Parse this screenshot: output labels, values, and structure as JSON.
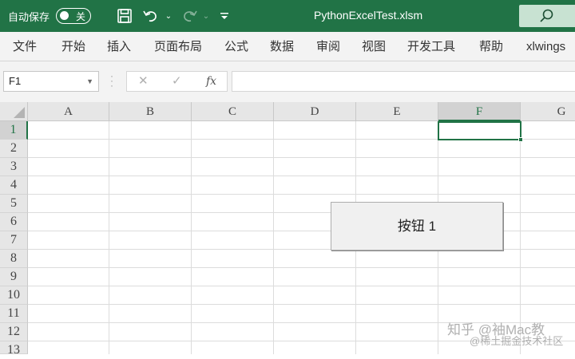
{
  "titlebar": {
    "autosave_label": "自动保存",
    "autosave_state": "关",
    "filename": "PythonExcelTest.xlsm",
    "icons": [
      "save-icon",
      "undo-icon",
      "redo-icon",
      "customize-toolbar-icon",
      "search-icon"
    ],
    "colors": {
      "accent": "#217346",
      "text": "#ffffff"
    }
  },
  "ribbon": {
    "tabs": [
      "文件",
      "开始",
      "插入",
      "页面布局",
      "公式",
      "数据",
      "审阅",
      "视图",
      "开发工具",
      "帮助",
      "xlwings"
    ]
  },
  "formula_bar": {
    "name_box": "F1",
    "cancel": "✕",
    "enter": "✓",
    "fx": "fx",
    "content": ""
  },
  "sheet": {
    "columns": [
      "A",
      "B",
      "C",
      "D",
      "E",
      "F",
      "G"
    ],
    "rows": [
      "1",
      "2",
      "3",
      "4",
      "5",
      "6",
      "7",
      "8",
      "9",
      "10",
      "11",
      "12",
      "13"
    ],
    "active_cell": "F1",
    "button_label": "按钮 1"
  },
  "watermark": {
    "line1": "知乎 @袖Mac教",
    "line2": "@稀土掘金技术社区"
  }
}
